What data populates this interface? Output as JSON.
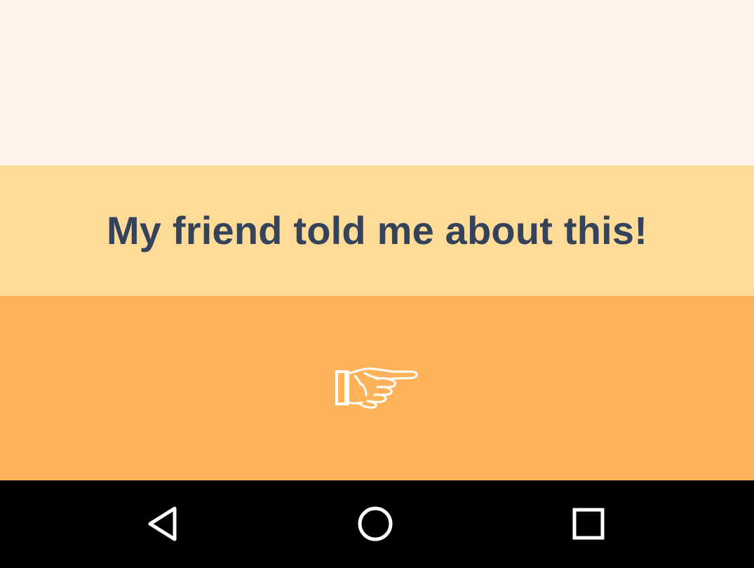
{
  "option": {
    "label": "My friend told me about this!"
  },
  "action": {
    "icon": "pointing-hand-icon"
  },
  "nav_bar": {
    "back_icon": "back-triangle-icon",
    "home_icon": "home-circle-icon",
    "recents_icon": "recents-square-icon"
  },
  "colors": {
    "top_background": "#fcf2e7",
    "option_background": "#fedb97",
    "option_text": "#34435a",
    "action_background": "#feb25a",
    "nav_background": "#000000",
    "icon_color": "#ffffff"
  }
}
